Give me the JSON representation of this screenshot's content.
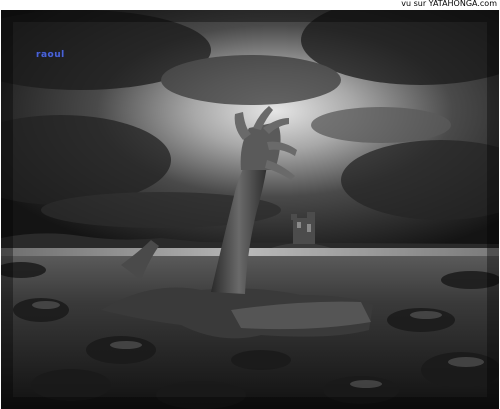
{
  "watermark": {
    "text": "vu sur YATAHONGA.com"
  },
  "photo": {
    "signature": "raoul",
    "scene_colors": {
      "sky_dark": "#1e1e1e",
      "sky_light": "#d8d8d8",
      "ground": "#2a2a2a",
      "water": "#9a9a9a"
    }
  }
}
